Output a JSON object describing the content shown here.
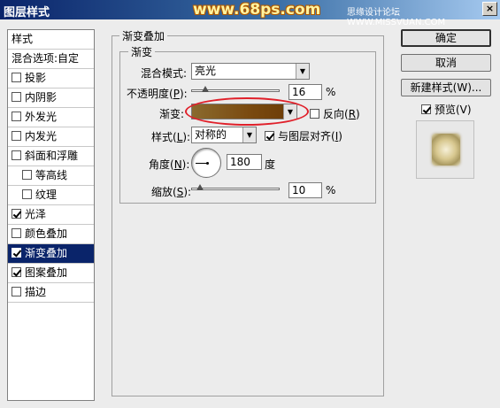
{
  "window": {
    "title": "图层样式",
    "watermark": "www.68ps.com",
    "site_text": "思缘设计论坛 WWW.MISSVUAN.COM",
    "close_label": "×"
  },
  "sidebar": {
    "header": "样式",
    "items": [
      {
        "label": "混合选项:自定",
        "checkbox": false,
        "checked": false,
        "indent": false,
        "selected": false
      },
      {
        "label": "投影",
        "checkbox": true,
        "checked": false,
        "indent": false,
        "selected": false
      },
      {
        "label": "内阴影",
        "checkbox": true,
        "checked": false,
        "indent": false,
        "selected": false
      },
      {
        "label": "外发光",
        "checkbox": true,
        "checked": false,
        "indent": false,
        "selected": false
      },
      {
        "label": "内发光",
        "checkbox": true,
        "checked": false,
        "indent": false,
        "selected": false
      },
      {
        "label": "斜面和浮雕",
        "checkbox": true,
        "checked": false,
        "indent": false,
        "selected": false
      },
      {
        "label": "等高线",
        "checkbox": true,
        "checked": false,
        "indent": true,
        "selected": false
      },
      {
        "label": "纹理",
        "checkbox": true,
        "checked": false,
        "indent": true,
        "selected": false
      },
      {
        "label": "光泽",
        "checkbox": true,
        "checked": true,
        "indent": false,
        "selected": false
      },
      {
        "label": "颜色叠加",
        "checkbox": true,
        "checked": false,
        "indent": false,
        "selected": false
      },
      {
        "label": "渐变叠加",
        "checkbox": true,
        "checked": true,
        "indent": false,
        "selected": true
      },
      {
        "label": "图案叠加",
        "checkbox": true,
        "checked": true,
        "indent": false,
        "selected": false
      },
      {
        "label": "描边",
        "checkbox": true,
        "checked": false,
        "indent": false,
        "selected": false
      }
    ]
  },
  "panel": {
    "outer_title": "渐变叠加",
    "inner_title": "渐变",
    "blend_mode_label": "混合模式:",
    "blend_mode_value": "亮光",
    "opacity_label_prefix": "不透明度(",
    "opacity_key": "P",
    "opacity_label_suffix": "):",
    "opacity_value": "16",
    "opacity_unit": "%",
    "opacity_level": 16,
    "gradient_label": "渐变:",
    "reverse_label_prefix": "反向(",
    "reverse_key": "R",
    "reverse_label_suffix": ")",
    "reverse_checked": false,
    "style_label_prefix": "样式(",
    "style_key": "L",
    "style_label_suffix": "):",
    "style_value": "对称的",
    "align_label_prefix": "与图层对齐(",
    "align_key": "I",
    "align_label_suffix": ")",
    "align_checked": true,
    "angle_label_prefix": "角度(",
    "angle_key": "N",
    "angle_label_suffix": "):",
    "angle_value": "180",
    "angle_unit": "度",
    "scale_label_prefix": "缩放(",
    "scale_key": "S",
    "scale_label_suffix": "):",
    "scale_value": "10",
    "scale_unit": "%",
    "scale_level": 10
  },
  "buttons": {
    "ok": "确定",
    "cancel": "取消",
    "new_style": "新建样式(W)...",
    "preview_label": "预览(V)",
    "preview_checked": true
  },
  "colors": {
    "selection": "#0a246a",
    "highlight_ellipse": "#e0202a",
    "gradient_start": "#8a6a2e",
    "gradient_end": "#6a3a05"
  }
}
